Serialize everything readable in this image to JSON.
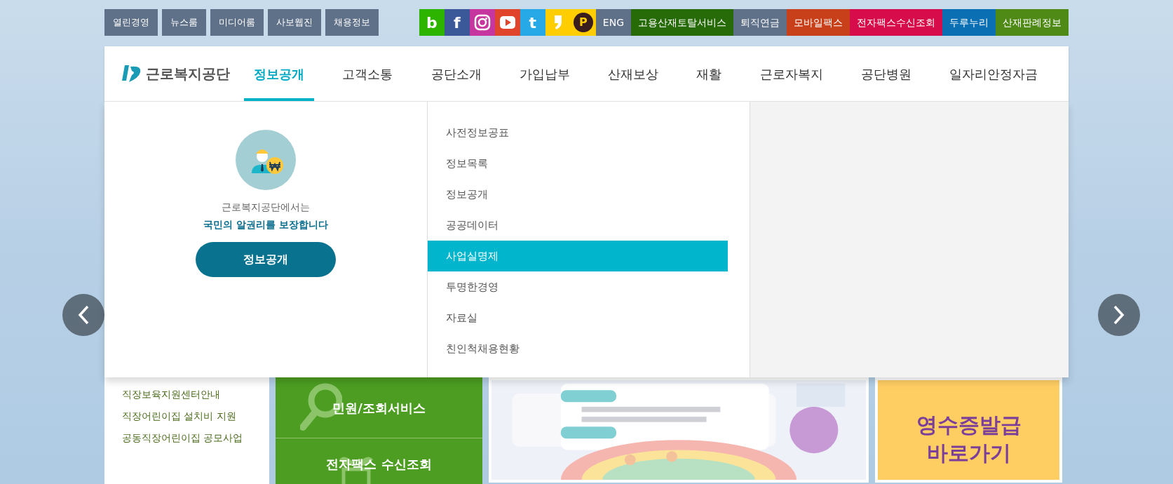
{
  "top_links": [
    "열린경영",
    "뉴스룸",
    "미디어룸",
    "사보웹진",
    "채용정보"
  ],
  "social": [
    {
      "kind": "glyph",
      "glyph": "b",
      "color": "#2db400"
    },
    {
      "kind": "glyph",
      "glyph": "f",
      "color": "#3b5998"
    },
    {
      "kind": "instagram",
      "color": "#c7369e"
    },
    {
      "kind": "youtube",
      "color": "#e0442a"
    },
    {
      "kind": "glyph",
      "glyph": "t",
      "color": "#27a9e8"
    },
    {
      "kind": "story",
      "color": "#ffcd00"
    },
    {
      "kind": "pcircle",
      "glyph": "P",
      "color": "#ffcd00"
    }
  ],
  "service_links": [
    {
      "label": "ENG",
      "color": "#5f7089"
    },
    {
      "label": "고용산재토탈서비스",
      "color": "#266b07"
    },
    {
      "label": "퇴직연금",
      "color": "#5f7089"
    },
    {
      "label": "모바일팩스",
      "color": "#c8401a"
    },
    {
      "label": "전자팩스수신조회",
      "color": "#d70c4a"
    },
    {
      "label": "두루누리",
      "color": "#0b6fb3"
    },
    {
      "label": "산재판례정보",
      "color": "#4f8a17"
    }
  ],
  "logo": {
    "text": "근로복지공단"
  },
  "nav": [
    {
      "label": "정보공개",
      "selected": true
    },
    {
      "label": "고객소통",
      "selected": false
    },
    {
      "label": "공단소개",
      "selected": false
    },
    {
      "label": "가입납부",
      "selected": false
    },
    {
      "label": "산재보상",
      "selected": false
    },
    {
      "label": "재활",
      "selected": false
    },
    {
      "label": "근로자복지",
      "selected": false
    },
    {
      "label": "공단병원",
      "selected": false
    },
    {
      "label": "일자리안정자금",
      "selected": false
    }
  ],
  "dropdown": {
    "intro_line": "근로복지공단에서는",
    "intro_highlight": "국민의 알권리를 보장합니다",
    "button": "정보공개",
    "items": [
      {
        "label": "사전정보공표",
        "selected": false
      },
      {
        "label": "정보목록",
        "selected": false
      },
      {
        "label": "정보공개",
        "selected": false
      },
      {
        "label": "공공데이터",
        "selected": false
      },
      {
        "label": "사업실명제",
        "selected": true
      },
      {
        "label": "투명한경영",
        "selected": false
      },
      {
        "label": "자료실",
        "selected": false
      },
      {
        "label": "친인척채용현황",
        "selected": false
      }
    ]
  },
  "side_links": [
    "직장보육지원센터안내",
    "직장어린이집 설치비 지원",
    "공동직장어린이집 공모사업"
  ],
  "tiles": [
    {
      "kind": "search",
      "label": "민원/조회서비스"
    },
    {
      "kind": "sprout",
      "label": "전자팩스 수신조회"
    }
  ],
  "donation_banner": {
    "lines": [
      "영수증발급",
      "바로가기"
    ]
  }
}
